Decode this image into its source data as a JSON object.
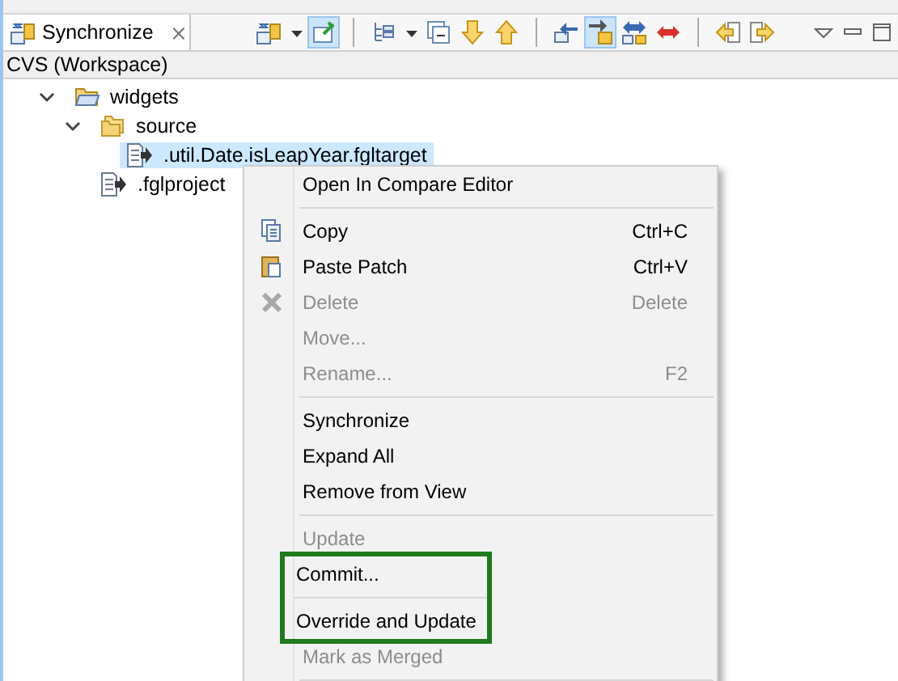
{
  "view_tab": {
    "title": "Synchronize",
    "close": "⨯"
  },
  "toolbar": [
    {
      "kind": "database",
      "selected": false
    },
    {
      "kind": "dropdown",
      "selected": false
    },
    {
      "kind": "pin",
      "selected": true
    },
    {
      "kind": "separator"
    },
    {
      "kind": "tree",
      "selected": false
    },
    {
      "kind": "dropdown",
      "selected": false
    },
    {
      "kind": "collapse",
      "selected": false
    },
    {
      "kind": "down",
      "selected": false
    },
    {
      "kind": "up",
      "selected": false
    },
    {
      "kind": "separator"
    },
    {
      "kind": "outgoing",
      "selected": false
    },
    {
      "kind": "incoming",
      "selected": true
    },
    {
      "kind": "both",
      "selected": false
    },
    {
      "kind": "conflict",
      "selected": false
    },
    {
      "kind": "separator"
    },
    {
      "kind": "prev",
      "selected": false
    },
    {
      "kind": "next",
      "selected": false
    }
  ],
  "header": "CVS (Workspace)",
  "tree": [
    {
      "label": "widgets",
      "kind": "openfolder",
      "expanded": true,
      "selected": false,
      "children": [
        {
          "label": "source",
          "kind": "folder",
          "expanded": true,
          "selected": false,
          "children": [
            {
              "label": ".util.Date.isLeapYear.fgltarget",
              "kind": "file",
              "selected": true
            }
          ]
        },
        {
          "label": ".fglproject",
          "kind": "file",
          "selected": false
        }
      ]
    }
  ],
  "context_menu": [
    {
      "kind": "item",
      "label": "Open In Compare Editor",
      "disabled": false,
      "outlined": false
    },
    {
      "kind": "separator"
    },
    {
      "kind": "copy",
      "label": "Copy",
      "shortcut": "Ctrl+C",
      "disabled": false,
      "outlined": false
    },
    {
      "kind": "paste",
      "label": "Paste Patch",
      "shortcut": "Ctrl+V",
      "disabled": false,
      "outlined": false
    },
    {
      "kind": "delete",
      "label": "Delete",
      "shortcut": "Delete",
      "disabled": true,
      "outlined": false
    },
    {
      "kind": "item",
      "label": "Move...",
      "disabled": true,
      "outlined": false
    },
    {
      "kind": "item",
      "label": "Rename...",
      "shortcut": "F2",
      "disabled": true,
      "outlined": false
    },
    {
      "kind": "separator"
    },
    {
      "kind": "item",
      "label": "Synchronize",
      "disabled": false,
      "outlined": false
    },
    {
      "kind": "item",
      "label": "Expand All",
      "disabled": false,
      "outlined": false
    },
    {
      "kind": "item",
      "label": "Remove from View",
      "disabled": false,
      "outlined": false
    },
    {
      "kind": "separator"
    },
    {
      "kind": "item",
      "label": "Update",
      "disabled": true,
      "outlined": false
    },
    {
      "kind": "item",
      "label": "Commit...",
      "disabled": false,
      "outlined": true
    },
    {
      "kind": "separator",
      "outlined": true
    },
    {
      "kind": "item",
      "label": "Override and Update",
      "disabled": false,
      "outlined": true
    },
    {
      "kind": "item",
      "label": "Mark as Merged",
      "disabled": true,
      "outlined": false
    },
    {
      "kind": "separator"
    }
  ]
}
